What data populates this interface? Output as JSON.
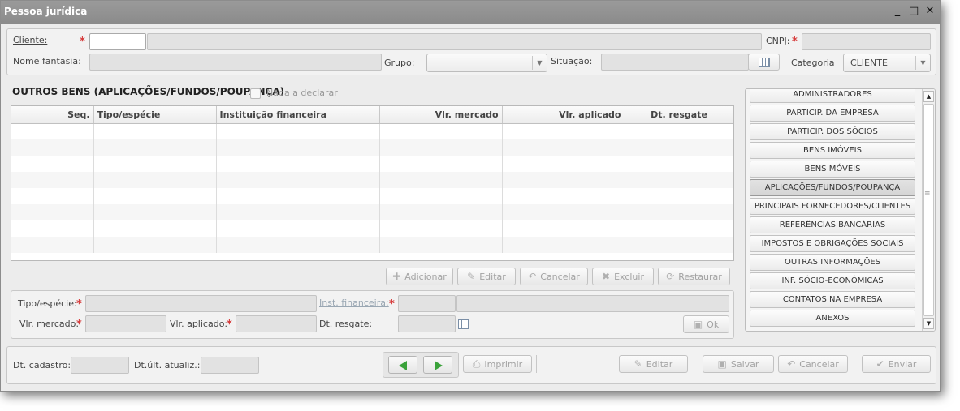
{
  "window": {
    "title": "Pessoa jurídica",
    "controls": [
      "_",
      "□",
      "✕"
    ]
  },
  "header": {
    "cliente_label": "Cliente:",
    "cliente_code": "",
    "cliente_name": "",
    "cnpj_label": "CNPJ:",
    "cnpj_value": "",
    "nome_fantasia_label": "Nome fantasia:",
    "nome_fantasia_value": "",
    "grupo_label": "Grupo:",
    "grupo_value": "",
    "situacao_label": "Situação:",
    "situacao_value": "",
    "categoria_label": "Categoria",
    "categoria_value": "CLIENTE"
  },
  "section": {
    "title": "OUTROS BENS (APLICAÇÕES/FUNDOS/POUPANÇA)",
    "nada_label": "Nada a declarar"
  },
  "grid": {
    "columns": [
      "Seq.",
      "Tipo/espécie",
      "Instituição financeira",
      "Vlr. mercado",
      "Vlr. aplicado",
      "Dt. resgate"
    ],
    "rows": []
  },
  "grid_actions": {
    "adicionar": "Adicionar",
    "editar": "Editar",
    "cancelar": "Cancelar",
    "excluir": "Excluir",
    "restaurar": "Restaurar"
  },
  "detail": {
    "tipo_label": "Tipo/espécie:",
    "inst_label": "Inst. financeira:",
    "vlr_mercado_label": "Vlr. mercado:",
    "vlr_aplicado_label": "Vlr. aplicado:",
    "dt_resgate_label": "Dt. resgate:",
    "ok_label": "Ok"
  },
  "side_menu": [
    "ADMINISTRADORES",
    "PARTICIP. DA EMPRESA",
    "PARTICIP. DOS SÓCIOS",
    "BENS IMÓVEIS",
    "BENS MÓVEIS",
    "APLICAÇÕES/FUNDOS/POUPANÇA",
    "PRINCIPAIS FORNECEDORES/CLIENTES",
    "REFERÊNCIAS BANCÁRIAS",
    "IMPOSTOS E OBRIGAÇÕES SOCIAIS",
    "OUTRAS INFORMAÇÕES",
    "INF. SÓCIO-ECONÔMICAS",
    "CONTATOS NA EMPRESA",
    "ANEXOS"
  ],
  "footer": {
    "dt_cadastro_label": "Dt. cadastro:",
    "dt_atualiz_label": "Dt.últ. atualiz.:",
    "imprimir": "Imprimir",
    "editar": "Editar",
    "salvar": "Salvar",
    "cancelar": "Cancelar",
    "enviar": "Enviar"
  }
}
